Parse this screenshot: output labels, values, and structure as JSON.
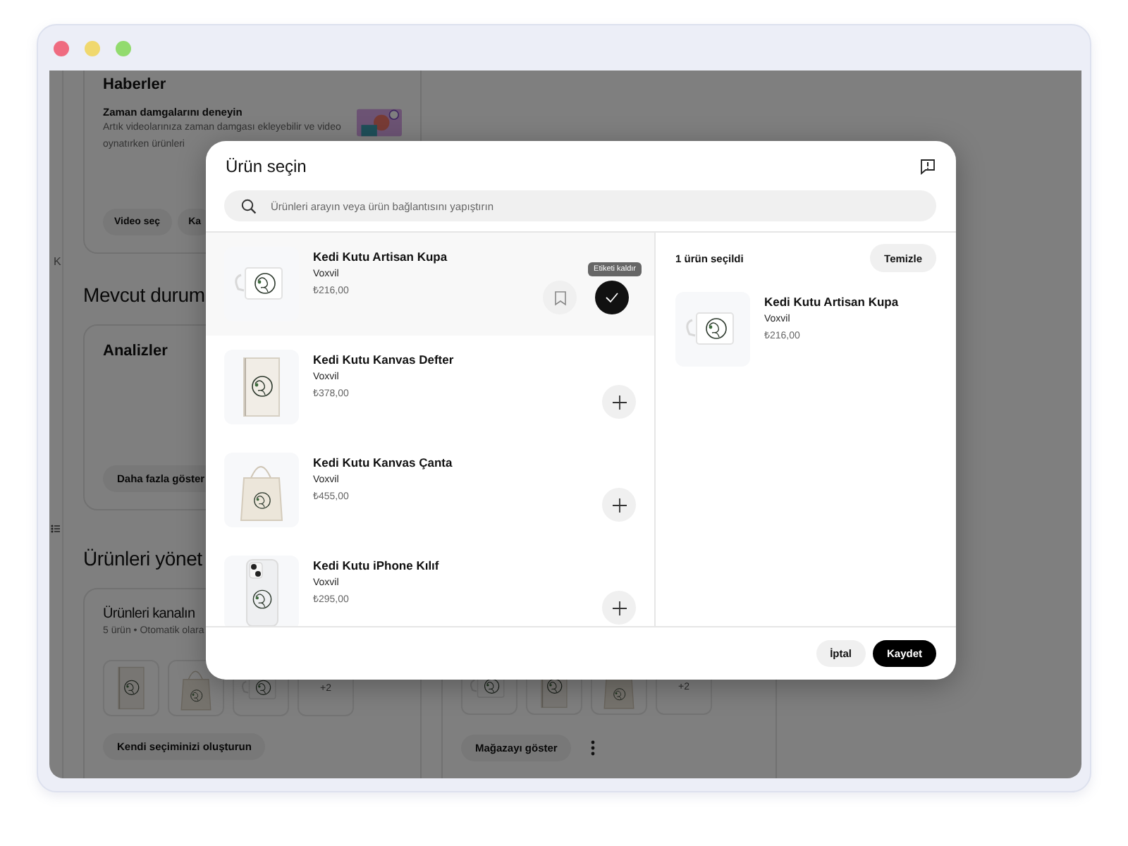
{
  "window": {
    "controls": [
      {
        "color": "#ef6b80"
      },
      {
        "color": "#f0d86e"
      },
      {
        "color": "#92db6e"
      }
    ]
  },
  "sidebar": {
    "label": "K"
  },
  "page": {
    "sections": [
      {
        "cards": [
          {
            "title": "Haberler",
            "news_title": "Zaman damgalarını deneyin",
            "news_text": "Artık videolarınıza zaman damgası ekleyebilir ve video oynatırken ürünleri",
            "buttons": [
              "Video seç",
              "Ka"
            ]
          }
        ]
      },
      {
        "heading": "Mevcut durum",
        "cards": [
          {
            "title": "Analizler",
            "buttons": [
              "Daha fazla göster"
            ]
          }
        ]
      },
      {
        "heading": "Ürünleri yönet",
        "cards": [
          {
            "title": "Ürünleri kanalın",
            "subtitle": "5 ürün • Otomatik olara",
            "thumbnails": [
              {
                "kind": "notebook"
              },
              {
                "kind": "tote"
              },
              {
                "kind": "mug"
              },
              {
                "kind": "more",
                "label": "+2"
              }
            ],
            "buttons": [
              "Kendi seçiminizi oluşturun"
            ]
          },
          {
            "thumbnails": [
              {
                "kind": "mug"
              },
              {
                "kind": "notebook"
              },
              {
                "kind": "tote"
              },
              {
                "kind": "more",
                "label": "+2"
              }
            ],
            "buttons": [
              "Mağazayı göster"
            ],
            "more_menu": true
          }
        ]
      }
    ]
  },
  "dialog": {
    "title": "Ürün seçin",
    "search": {
      "placeholder": "Ürünleri arayın veya ürün bağlantısını yapıştırın"
    },
    "products": [
      {
        "name": "Kedi Kutu Artisan Kupa",
        "brand": "Voxvil",
        "price": "₺216,00",
        "kind": "mug",
        "selected": true,
        "tooltip": "Etiketi kaldır"
      },
      {
        "name": "Kedi Kutu Kanvas Defter",
        "brand": "Voxvil",
        "price": "₺378,00",
        "kind": "notebook",
        "selected": false
      },
      {
        "name": "Kedi Kutu Kanvas Çanta",
        "brand": "Voxvil",
        "price": "₺455,00",
        "kind": "tote",
        "selected": false
      },
      {
        "name": "Kedi Kutu iPhone Kılıf",
        "brand": "Voxvil",
        "price": "₺295,00",
        "kind": "phone",
        "selected": false
      }
    ],
    "selection": {
      "summary": "1 ürün seçildi",
      "clear_button": "Temizle",
      "items": [
        {
          "name": "Kedi Kutu Artisan Kupa",
          "brand": "Voxvil",
          "price": "₺216,00",
          "kind": "mug"
        }
      ]
    },
    "buttons": [
      {
        "label": "İptal",
        "kind": "secondary"
      },
      {
        "label": "Kaydet",
        "kind": "primary"
      }
    ]
  }
}
